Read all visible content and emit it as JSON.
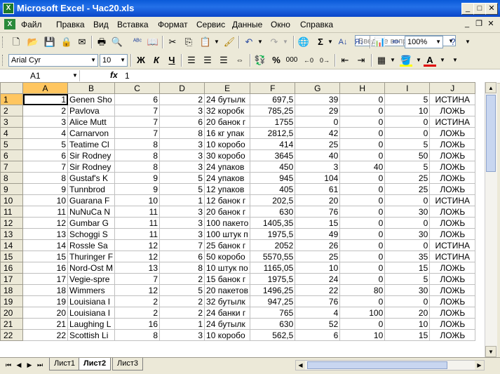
{
  "window": {
    "title": "Microsoft Excel - Час20.xls",
    "app_icon": "excel-icon",
    "minimize": "_",
    "maximize": "□",
    "close": "✕"
  },
  "menu": [
    "Файл",
    "Правка",
    "Вид",
    "Вставка",
    "Формат",
    "Сервис",
    "Данные",
    "Окно",
    "Справка"
  ],
  "help": {
    "placeholder": "Введите вопрос"
  },
  "toolbar": {
    "zoom": "100%"
  },
  "format_toolbar": {
    "font": "Arial Cyr",
    "size": "10",
    "bold": "Ж",
    "italic": "К",
    "underline": "Ч",
    "percent": "%",
    "thousands": "000"
  },
  "formula_bar": {
    "name_box": "A1",
    "fx_label": "fx",
    "value": "1"
  },
  "grid": {
    "columns": [
      "A",
      "B",
      "C",
      "D",
      "E",
      "F",
      "G",
      "H",
      "I",
      "J"
    ],
    "rows": [
      [
        "1",
        "1",
        "Genen Sho",
        "6",
        "2",
        "24 бутылк",
        "697,5",
        "39",
        "0",
        "5",
        "ИСТИНА"
      ],
      [
        "2",
        "2",
        "Pavlova",
        "7",
        "3",
        "32 коробк",
        "785,25",
        "29",
        "0",
        "10",
        "ЛОЖЬ"
      ],
      [
        "3",
        "3",
        "Alice Mutt",
        "7",
        "6",
        "20 банок г",
        "1755",
        "0",
        "0",
        "0",
        "ИСТИНА"
      ],
      [
        "4",
        "4",
        "Carnarvon",
        "7",
        "8",
        "16 кг упак",
        "2812,5",
        "42",
        "0",
        "0",
        "ЛОЖЬ"
      ],
      [
        "5",
        "5",
        "Teatime Cl",
        "8",
        "3",
        "10 коробо",
        "414",
        "25",
        "0",
        "5",
        "ЛОЖЬ"
      ],
      [
        "6",
        "6",
        "Sir Rodney",
        "8",
        "3",
        "30 коробо",
        "3645",
        "40",
        "0",
        "50",
        "ЛОЖЬ"
      ],
      [
        "7",
        "7",
        "Sir Rodney",
        "8",
        "3",
        "24 упаков",
        "450",
        "3",
        "40",
        "5",
        "ЛОЖЬ"
      ],
      [
        "8",
        "8",
        "Gustaf's K",
        "9",
        "5",
        "24 упаков",
        "945",
        "104",
        "0",
        "25",
        "ЛОЖЬ"
      ],
      [
        "9",
        "9",
        "Tunnbrod",
        "9",
        "5",
        "12 упаков",
        "405",
        "61",
        "0",
        "25",
        "ЛОЖЬ"
      ],
      [
        "10",
        "10",
        "Guarana F",
        "10",
        "1",
        "12 банок г",
        "202,5",
        "20",
        "0",
        "0",
        "ИСТИНА"
      ],
      [
        "11",
        "11",
        "NuNuCa N",
        "11",
        "3",
        "20 банок г",
        "630",
        "76",
        "0",
        "30",
        "ЛОЖЬ"
      ],
      [
        "12",
        "12",
        "Gumbar G",
        "11",
        "3",
        "100 пакето",
        "1405,35",
        "15",
        "0",
        "0",
        "ЛОЖЬ"
      ],
      [
        "13",
        "13",
        "Schoggi S",
        "11",
        "3",
        "100 штук п",
        "1975,5",
        "49",
        "0",
        "30",
        "ЛОЖЬ"
      ],
      [
        "14",
        "14",
        "Rossle Sa",
        "12",
        "7",
        "25 банок г",
        "2052",
        "26",
        "0",
        "0",
        "ИСТИНА"
      ],
      [
        "15",
        "15",
        "Thuringer F",
        "12",
        "6",
        "50 коробо",
        "5570,55",
        "25",
        "0",
        "35",
        "ИСТИНА"
      ],
      [
        "16",
        "16",
        "Nord-Ost M",
        "13",
        "8",
        "10 штук по",
        "1165,05",
        "10",
        "0",
        "15",
        "ЛОЖЬ"
      ],
      [
        "17",
        "17",
        "Vegie-spre",
        "7",
        "2",
        "15 банок г",
        "1975,5",
        "24",
        "0",
        "5",
        "ЛОЖЬ"
      ],
      [
        "18",
        "18",
        "Wimmers",
        "12",
        "5",
        "20 пакетов",
        "1496,25",
        "22",
        "80",
        "30",
        "ЛОЖЬ"
      ],
      [
        "19",
        "19",
        "Louisiana I",
        "2",
        "2",
        "32 бутылк",
        "947,25",
        "76",
        "0",
        "0",
        "ЛОЖЬ"
      ],
      [
        "20",
        "20",
        "Louisiana I",
        "2",
        "2",
        "24 банки г",
        "765",
        "4",
        "100",
        "20",
        "ЛОЖЬ"
      ],
      [
        "21",
        "21",
        "Laughing L",
        "16",
        "1",
        "24 бутылк",
        "630",
        "52",
        "0",
        "10",
        "ЛОЖЬ"
      ],
      [
        "22",
        "22",
        "Scottish Li",
        "8",
        "3",
        "10 коробо",
        "562,5",
        "6",
        "10",
        "15",
        "ЛОЖЬ"
      ]
    ]
  },
  "sheets": {
    "tabs": [
      "Лист1",
      "Лист2",
      "Лист3"
    ],
    "active": "Лист2"
  }
}
